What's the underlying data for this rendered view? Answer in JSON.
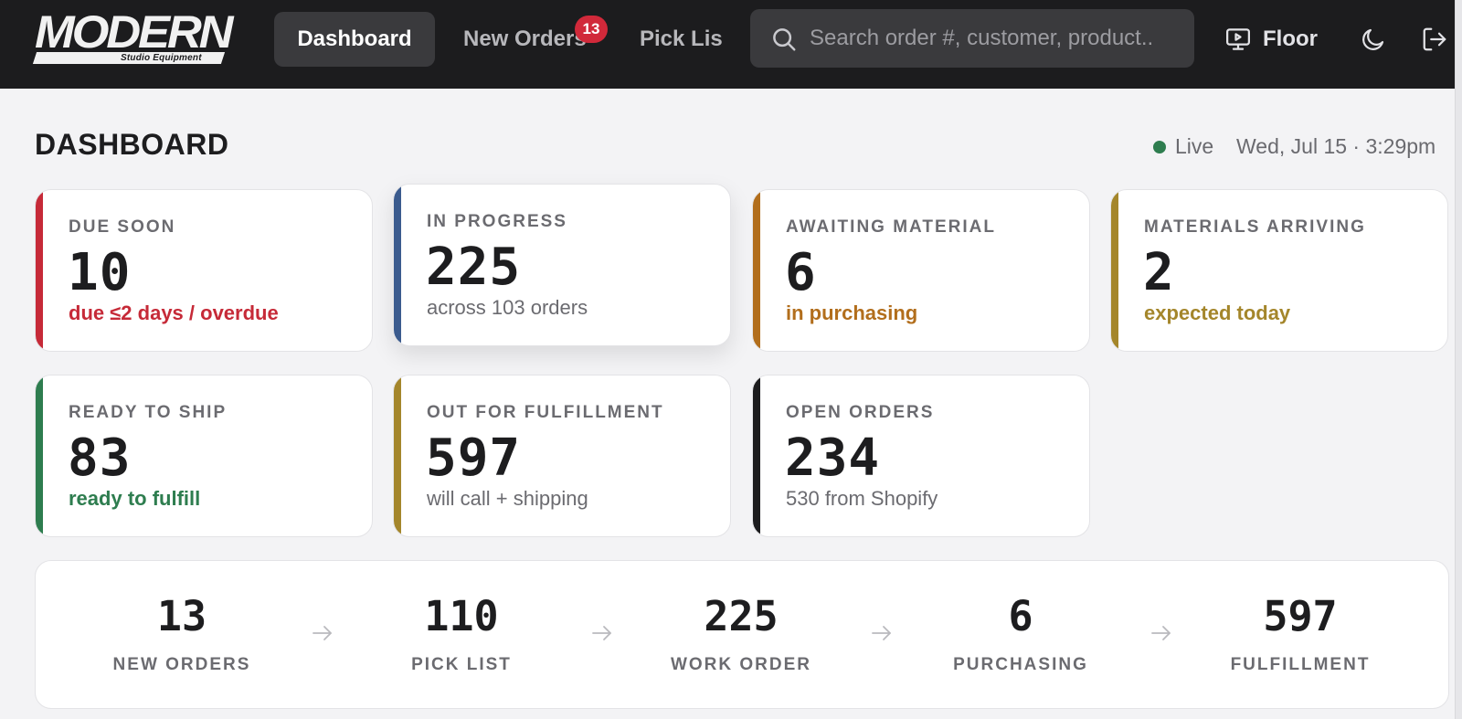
{
  "brand": {
    "name": "MODERN",
    "tagline": "Studio Equipment"
  },
  "nav": {
    "dashboard": "Dashboard",
    "new_orders": "New Orders",
    "new_orders_badge": "13",
    "pick_list": "Pick Lis"
  },
  "search": {
    "placeholder": "Search order #, customer, product.."
  },
  "floor_label": "Floor",
  "header": {
    "title": "DASHBOARD",
    "live_label": "Live",
    "timestamp": "Wed, Jul 15 · 3:29pm"
  },
  "cards": [
    {
      "label": "DUE SOON",
      "value": "10",
      "sub": "due ≤2 days / overdue",
      "accent": "#c62a38",
      "sub_color": "#c62a38"
    },
    {
      "label": "IN PROGRESS",
      "value": "225",
      "sub": "across 103 orders",
      "accent": "#3b5b8e",
      "sub_color": "#6b6b70"
    },
    {
      "label": "AWAITING MATERIAL",
      "value": "6",
      "sub": "in purchasing",
      "accent": "#b26e1c",
      "sub_color": "#b26e1c"
    },
    {
      "label": "MATERIALS ARRIVING",
      "value": "2",
      "sub": "expected today",
      "accent": "#a4862b",
      "sub_color": "#a4862b"
    },
    {
      "label": "READY TO SHIP",
      "value": "83",
      "sub": "ready to fulfill",
      "accent": "#2e7d4f",
      "sub_color": "#2e7d4f"
    },
    {
      "label": "OUT FOR FULFILLMENT",
      "value": "597",
      "sub": "will call + shipping",
      "accent": "#a4862b",
      "sub_color": "#6b6b70"
    },
    {
      "label": "OPEN ORDERS",
      "value": "234",
      "sub": "530 from Shopify",
      "accent": "#1c1c1e",
      "sub_color": "#6b6b70"
    }
  ],
  "pipeline": [
    {
      "value": "13",
      "label": "NEW ORDERS"
    },
    {
      "value": "110",
      "label": "PICK LIST"
    },
    {
      "value": "225",
      "label": "WORK ORDER"
    },
    {
      "value": "6",
      "label": "PURCHASING"
    },
    {
      "value": "597",
      "label": "FULFILLMENT"
    }
  ]
}
